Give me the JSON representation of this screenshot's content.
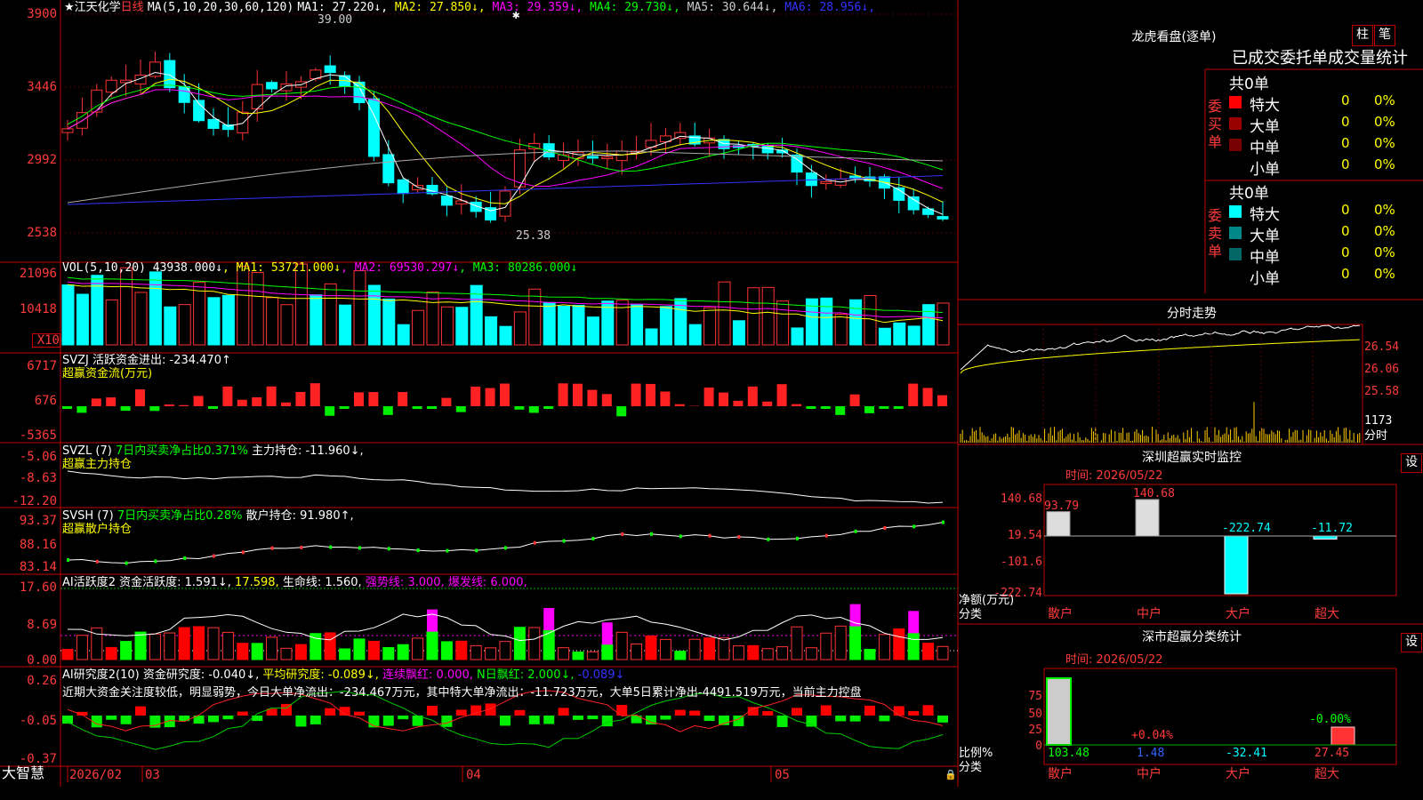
{
  "stock": {
    "name": "江天化学",
    "period": "日线",
    "star": "★"
  },
  "ma_line": {
    "prefix": "MA(5,10,20,30,60,120)",
    "items": [
      {
        "text": "MA1: 27.220↓",
        "color": "#ffffff"
      },
      {
        "text": "MA2: 27.850↓",
        "color": "#ffff00"
      },
      {
        "text": "MA3: 29.359↓",
        "color": "#ff00ff"
      },
      {
        "text": "MA4: 29.730↓",
        "color": "#00ff00"
      },
      {
        "text": "MA5: 30.644↓",
        "color": "#cccccc"
      },
      {
        "text": "MA6: 28.956↓",
        "color": "#3333ff"
      }
    ],
    "high_label": "39.00",
    "low_label": "25.38"
  },
  "price_axis": [
    "3900",
    "3446",
    "2992",
    "2538"
  ],
  "vol": {
    "prefix": "VOL(5,10,20)",
    "value": "43938.000↓",
    "items": [
      {
        "text": "MA1: 53721.000↓",
        "color": "#ffff00"
      },
      {
        "text": "MA2: 69530.297↓",
        "color": "#ff00ff"
      },
      {
        "text": "MA3: 80286.000↓",
        "color": "#00ff00"
      }
    ],
    "axis": [
      "21096",
      "10418"
    ],
    "unit": "X10"
  },
  "svzj": {
    "line1": "SVZJ  活跃资金进出: -234.470↑",
    "line2": "超赢资金流(万元)",
    "axis": [
      "6717",
      "676",
      "-5365"
    ]
  },
  "svzl": {
    "line1a": "SVZL (7)",
    "line1b": "7日内买卖净占比0.371%",
    "line1c": "主力持仓: -11.960↓,",
    "line2": "超赢主力持仓",
    "axis": [
      "-5.06",
      "-8.63",
      "-12.20"
    ]
  },
  "svsh": {
    "line1a": "SVSH (7)",
    "line1b": "7日内买卖净占比0.28%",
    "line1c": "散户持仓: 91.980↑,",
    "line2": "超赢散户持仓",
    "axis": [
      "93.37",
      "88.16",
      "83.14"
    ]
  },
  "ai_active": {
    "prefix": "AI活跃度2",
    "t1": "资金活跃度: 1.591↓,",
    "t2": "17.598,",
    "t3": "生命线: 1.560,",
    "t4": "强势线: 3.000,",
    "t5": "爆发线: 6.000,",
    "axis": [
      "17.60",
      "8.69",
      "0.00"
    ]
  },
  "ai_research": {
    "prefix": "AI研究度2(10)",
    "t1": "资金研究度: -0.040↓,",
    "t2": "平均研究度: -0.089↓,",
    "t3": "连续飘红: 0.000,",
    "t4": "N日飘红: 2.000↓,",
    "t5": "-0.089↓",
    "comment": "近期大资金关注度较低，明显弱势，今日大单净流出：-234.467万元，其中特大单净流出：-11.723万元，大单5日累计净出-4491.519万元，当前主力控盘",
    "axis": [
      "0.26",
      "-0.05",
      "-0.37"
    ]
  },
  "date_axis": {
    "brand": "大智慧",
    "labels": [
      "2026/02",
      "03",
      "04",
      "05"
    ]
  },
  "right": {
    "dragon_title": "龙虎看盘(逐单)",
    "btn_zhu": "柱",
    "btn_bi": "笔",
    "stats_header": "已成交委托单成交量统计",
    "buy": {
      "side": "委买单",
      "total": "共0单",
      "rows": [
        {
          "label": "特大",
          "val": "0",
          "pct": "0%",
          "color": "#ff0000"
        },
        {
          "label": "大单",
          "val": "0",
          "pct": "0%",
          "color": "#990000"
        },
        {
          "label": "中单",
          "val": "0",
          "pct": "0%",
          "color": "#770000"
        },
        {
          "label": "小单",
          "val": "0",
          "pct": "0%",
          "color": "#000000"
        }
      ]
    },
    "sell": {
      "side": "委卖单",
      "total": "共0单",
      "rows": [
        {
          "label": "特大",
          "val": "0",
          "pct": "0%",
          "color": "#00ffff"
        },
        {
          "label": "大单",
          "val": "0",
          "pct": "0%",
          "color": "#008888"
        },
        {
          "label": "中单",
          "val": "0",
          "pct": "0%",
          "color": "#006666"
        },
        {
          "label": "小单",
          "val": "0",
          "pct": "0%",
          "color": "#000000"
        }
      ]
    },
    "timeshare": {
      "title": "分时走势",
      "axis": [
        "26.54",
        "26.06",
        "25.58"
      ],
      "vol_axis": [
        "1173",
        "分时"
      ]
    },
    "sz_monitor": {
      "title": "深圳超赢实时监控",
      "btn": "设",
      "time": "时间: 2026/05/22",
      "axis": [
        "140.68",
        "19.54",
        "-101.6",
        "-222.74"
      ],
      "unit1": "净额(万元)",
      "unit2": "分类",
      "cats": [
        "散户",
        "中户",
        "大户",
        "超大"
      ],
      "values": [
        93.79,
        140.68,
        -222.74,
        -11.72
      ],
      "labels": [
        "93.79",
        "140.68",
        "-222.74",
        "-11.72"
      ]
    },
    "sz_class": {
      "title": "深市超赢分类统计",
      "btn": "设",
      "time": "时间: 2026/05/22",
      "axis": [
        "75",
        "50",
        "25",
        "0"
      ],
      "unit1": "比例%",
      "unit2": "分类",
      "cats": [
        "散户",
        "中户",
        "大户",
        "超大"
      ],
      "top_labels": [
        "",
        "+0.04%",
        "",
        "-0.00%"
      ],
      "bottom_labels": [
        "103.48",
        "1.48",
        "-32.41",
        "27.45"
      ]
    }
  },
  "chart_data": [
    {
      "type": "candlestick",
      "title": "江天化学 日线",
      "ylim": [
        2538,
        3900
      ],
      "high": 39.0,
      "low": 25.38,
      "ma": {
        "MA1": 27.22,
        "MA2": 27.85,
        "MA3": 29.359,
        "MA4": 29.73,
        "MA5": 30.644,
        "MA6": 28.956
      }
    },
    {
      "type": "bar",
      "title": "VOL(5,10,20)",
      "value": 43938.0,
      "ma": {
        "MA1": 53721.0,
        "MA2": 69530.297,
        "MA3": 80286.0
      },
      "ylim": [
        0,
        21096
      ]
    },
    {
      "type": "bar",
      "title": "深圳超赢实时监控",
      "categories": [
        "散户",
        "中户",
        "大户",
        "超大"
      ],
      "values": [
        93.79,
        140.68,
        -222.74,
        -11.72
      ],
      "ylim": [
        -222.74,
        140.68
      ]
    },
    {
      "type": "bar",
      "title": "深市超赢分类统计",
      "categories": [
        "散户",
        "中户",
        "大户",
        "超大"
      ],
      "values": [
        103.48,
        1.48,
        -32.41,
        27.45
      ]
    }
  ]
}
